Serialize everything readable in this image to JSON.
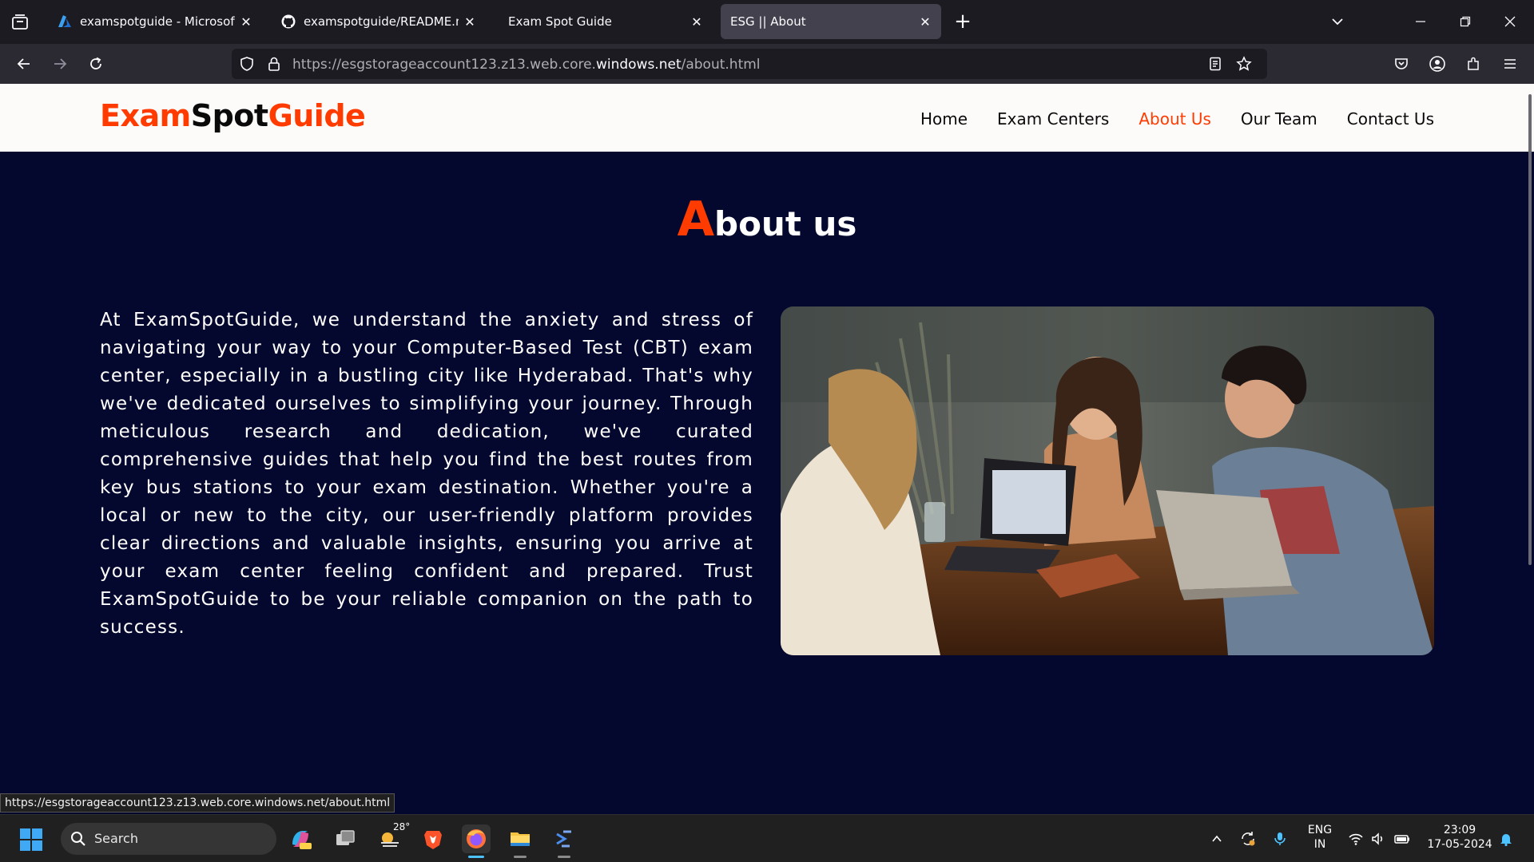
{
  "browser": {
    "tabs": [
      {
        "title": "examspotguide - Microsoft Azu",
        "icon": "azure-icon",
        "active": false
      },
      {
        "title": "examspotguide/README.md at",
        "icon": "github-icon",
        "active": false
      },
      {
        "title": "Exam Spot Guide",
        "icon": "none",
        "active": false
      },
      {
        "title": "ESG || About",
        "icon": "none",
        "active": true
      }
    ],
    "url_prefix": "https://esgstorageaccount123.z13.web.core.",
    "url_domain": "windows.net",
    "url_path": "/about.html",
    "status_url": "https://esgstorageaccount123.z13.web.core.windows.net/about.html"
  },
  "site": {
    "logo_part1": "Exam",
    "logo_part2": "Spot",
    "logo_part3": "Guide",
    "nav": [
      {
        "label": "Home",
        "active": false
      },
      {
        "label": "Exam Centers",
        "active": false
      },
      {
        "label": "About Us",
        "active": true
      },
      {
        "label": "Our Team",
        "active": false
      },
      {
        "label": "Contact Us",
        "active": false
      }
    ],
    "accent_color": "#ff3b00",
    "background_color": "#05082e"
  },
  "main": {
    "title_first_letter": "A",
    "title_rest": "bout us",
    "body": "At ExamSpotGuide, we understand the anxiety and stress of navigating your way to your Computer-Based Test (CBT) exam center, especially in a bustling city like Hyderabad. That's why we've dedicated ourselves to simplifying your journey. Through meticulous research and dedication, we've curated comprehensive guides that help you find the best routes from key bus stations to your exam destination. Whether you're a local or new to the city, our user-friendly platform provides clear directions and valuable insights, ensuring you arrive at your exam center feeling confident and prepared. Trust ExamSpotGuide to be your reliable companion on the path to success."
  },
  "taskbar": {
    "search_label": "Search",
    "weather_temp": "28°",
    "lang_line1": "ENG",
    "lang_line2": "IN",
    "time": "23:09",
    "date": "17-05-2024"
  }
}
